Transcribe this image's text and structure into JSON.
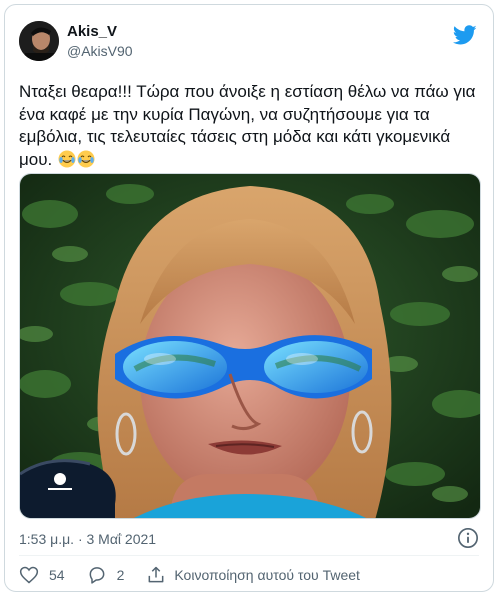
{
  "user": {
    "display_name": "Akis_V",
    "handle": "@AkisV90",
    "avatar_icon": "profile-photo"
  },
  "brand": {
    "icon": "twitter-bird-icon",
    "color": "#1d9bf0"
  },
  "tweet": {
    "text": "Νταξει θεαρα!!! Τώρα που άνοιξε η εστίαση θέλω να πάω για ένα καφέ με την κυρία Παγώνη, να συζητήσουμε για τα εμβόλια, τις τελευταίες τάσεις στη μόδα και κάτι γκομενικά μου.",
    "emojis": [
      "face-with-tears-of-joy",
      "face-with-tears-of-joy"
    ],
    "timestamp": "1:53 μ.μ. · 3 Μαΐ 2021"
  },
  "actions": {
    "like_count": "54",
    "reply_count": "2",
    "share_label": "Κοινοποίηση αυτού του Tweet"
  },
  "colors": {
    "text": "#0f1419",
    "secondary": "#536471",
    "border": "#cfd9de",
    "sunglasses": "#1e90ff"
  }
}
